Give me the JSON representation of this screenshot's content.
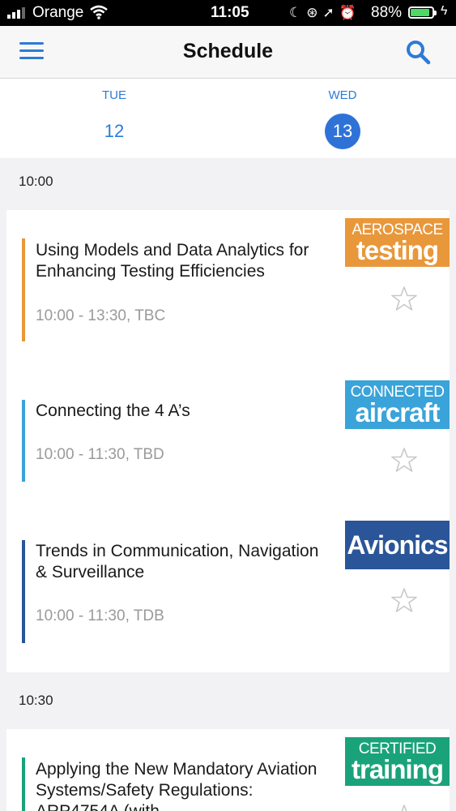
{
  "status_bar": {
    "carrier": "Orange",
    "time": "11:05",
    "battery": "88%",
    "battery_level": 0.88,
    "icons": [
      "signal-icon",
      "wifi-icon",
      "moon-icon",
      "rotation-lock-icon",
      "location-icon",
      "alarm-icon",
      "battery-icon",
      "charging-icon"
    ]
  },
  "header": {
    "title": "Schedule",
    "menu_icon": "hamburger-menu-icon",
    "search_icon": "search-icon"
  },
  "days": [
    {
      "name": "TUE",
      "number": "12",
      "selected": false
    },
    {
      "name": "WED",
      "number": "13",
      "selected": true
    }
  ],
  "accent_color": "#2f72d7",
  "slots": [
    {
      "time": "10:00",
      "sessions": [
        {
          "title": "Using Models and Data Analytics for Enhancing Testing Efficiencies",
          "time": "10:00 - 13:30, TBC",
          "color": "#e8973a",
          "logo_small": "AEROSPACE",
          "logo_big": "testing",
          "logo_bg": "#e8973a"
        },
        {
          "title": "Connecting the 4 A’s",
          "time": "10:00 - 11:30, TBD",
          "color": "#3aa3d9",
          "logo_small": "CONNECTED",
          "logo_big": "aircraft",
          "logo_bg": "#3aa3d9"
        },
        {
          "title": "Trends in Communication, Navigation & Surveillance",
          "time": "10:00 - 11:30, TDB",
          "color": "#2a5599",
          "logo_small": "",
          "logo_big": "Avionics",
          "logo_bg": "#2a5599"
        }
      ]
    },
    {
      "time": "10:30",
      "sessions": [
        {
          "title": "Applying the New Mandatory Aviation Systems/Safety Regulations: ARP4754A (with",
          "time": "",
          "color": "#1aa37a",
          "logo_small": "CERTIFIED",
          "logo_big": "training",
          "logo_bg": "#1aa37a"
        }
      ]
    }
  ]
}
